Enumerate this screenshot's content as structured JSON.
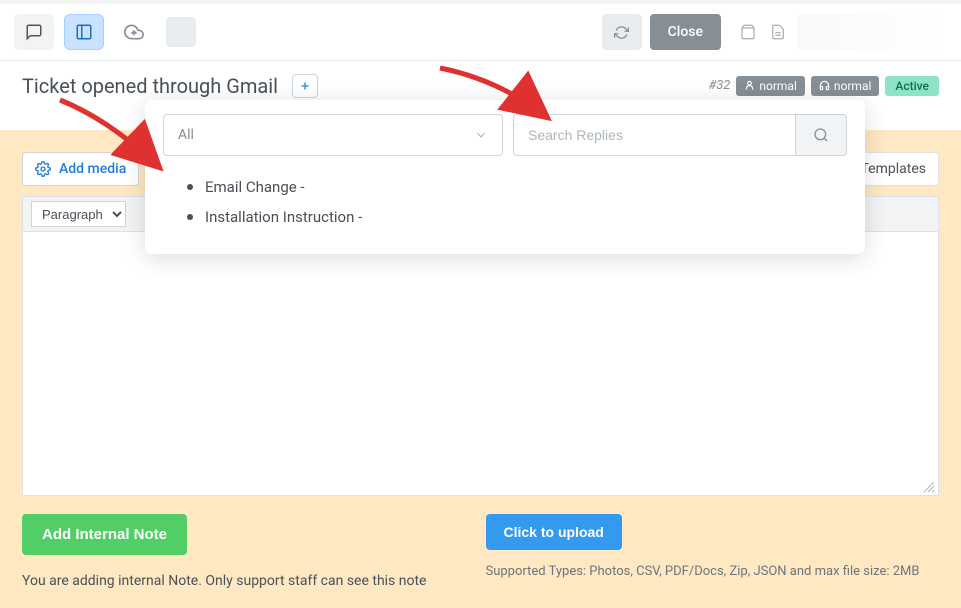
{
  "toolbar": {
    "close_label": "Close"
  },
  "ticket": {
    "title": "Ticket opened through Gmail",
    "number": "#32",
    "badge_priority": "normal",
    "badge_assignee": "normal",
    "badge_status": "Active"
  },
  "editor": {
    "add_media_label": "Add media",
    "templates_label": "Templates",
    "paragraph_label": "Paragraph"
  },
  "dropdown": {
    "filter_label": "All",
    "search_placeholder": "Search Replies",
    "items": [
      "Email Change -",
      "Installation Instruction -"
    ]
  },
  "actions": {
    "add_note_label": "Add Internal Note",
    "note_hint": "You are adding internal Note. Only support staff can see this note",
    "upload_label": "Click to upload",
    "upload_hint": "Supported Types: Photos, CSV, PDF/Docs, Zip, JSON and max file size: 2MB"
  }
}
